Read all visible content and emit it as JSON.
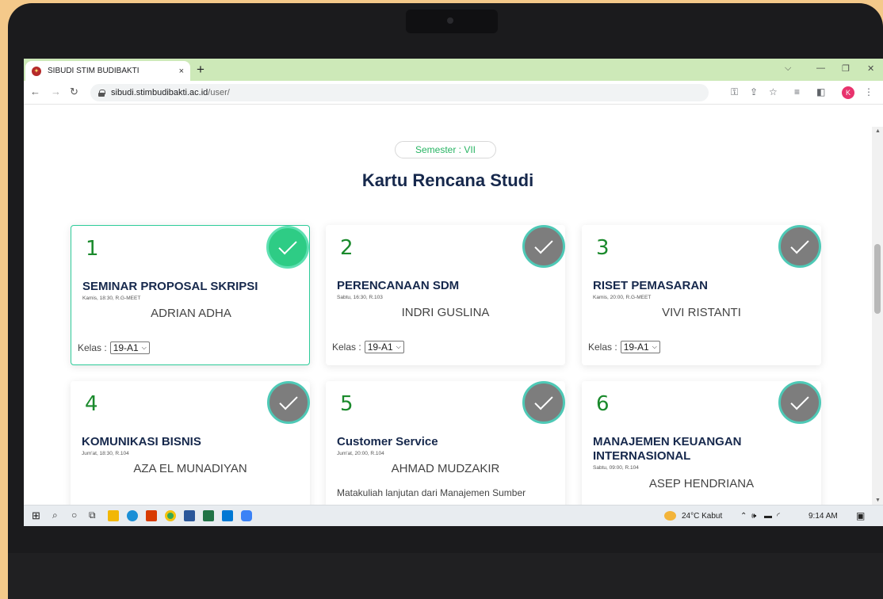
{
  "browser": {
    "tab_title": "SIBUDI STIM BUDIBAKTI",
    "tab_close": "×",
    "new_tab": "+",
    "url_domain": "sibudi.stimbudibakti.ac.id",
    "url_path": "/user/",
    "profile_initial": "K"
  },
  "page": {
    "semester": "Semester : VII",
    "title": "Kartu Rencana Studi",
    "kelas_label": "Kelas :",
    "cards": [
      {
        "number": "1",
        "course": "SEMINAR PROPOSAL SKRIPSI",
        "schedule": "Kamis, 18:30, R.G-MEET",
        "lecturer": "ADRIAN ADHA",
        "kelas": "19-A1",
        "selected": true
      },
      {
        "number": "2",
        "course": "PERENCANAAN SDM",
        "schedule": "Sabtu, 16:30, R.103",
        "lecturer": "INDRI GUSLINA",
        "kelas": "19-A1",
        "selected": false
      },
      {
        "number": "3",
        "course": "RISET PEMASARAN",
        "schedule": "Kamis, 20:00, R.G-MEET",
        "lecturer": "VIVI RISTANTI",
        "kelas": "19-A1",
        "selected": false
      },
      {
        "number": "4",
        "course": "KOMUNIKASI BISNIS",
        "schedule": "Jum'at, 18:30, R.104",
        "lecturer": "AZA EL MUNADIYAN",
        "selected": false
      },
      {
        "number": "5",
        "course": "Customer Service",
        "schedule": "Jum'at, 20:00, R.104",
        "lecturer": "AHMAD MUDZAKIR",
        "description": "Matakuliah lanjutan dari Manajemen Sumber",
        "selected": false
      },
      {
        "number": "6",
        "course": "MANAJEMEN KEUANGAN INTERNASIONAL",
        "schedule": "Sabtu, 09:00, R.104",
        "lecturer": "ASEP HENDRIANA",
        "selected": false
      }
    ]
  },
  "taskbar": {
    "weather": "24°C Kabut",
    "time": "9:14 AM"
  },
  "colors": {
    "accent_green": "#2ecc85",
    "title_navy": "#16284c",
    "tab_strip": "#cde9b8"
  }
}
